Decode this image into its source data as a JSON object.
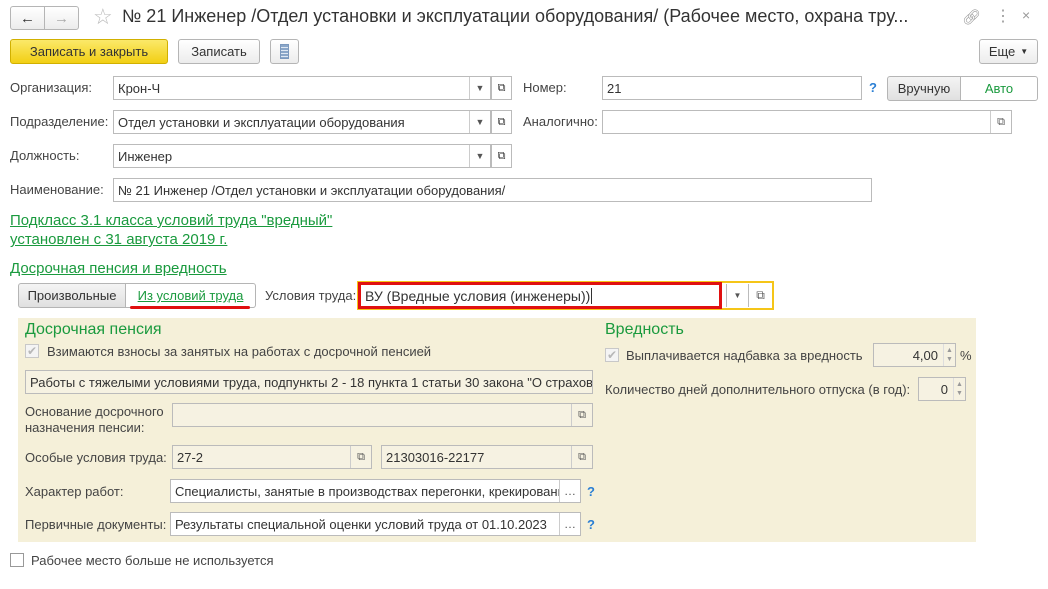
{
  "window": {
    "title": "№ 21 Инженер /Отдел установки и эксплуатации оборудования/ (Рабочее место, охрана тру..."
  },
  "toolbar": {
    "save_close": "Записать и закрыть",
    "save": "Записать",
    "more": "Еще"
  },
  "fields": {
    "org_label": "Организация:",
    "org_value": "Крон-Ч",
    "number_label": "Номер:",
    "number_value": "21",
    "help": "?",
    "manual": "Вручную",
    "auto": "Авто",
    "dept_label": "Подразделение:",
    "dept_value": "Отдел установки и эксплуатации оборудования",
    "similar_label": "Аналогично:",
    "similar_value": "",
    "position_label": "Должность:",
    "position_value": "Инженер",
    "name_label": "Наименование:",
    "name_value": "№ 21 Инженер /Отдел установки и эксплуатации оборудования/"
  },
  "subclass_link": {
    "line1": "Подкласс 3.1 класса условий труда \"вредный\"",
    "line2": "установлен с 31 августа 2019 г."
  },
  "section_link": "Досрочная пенсия и вредность",
  "mode": {
    "arbitrary": "Произвольные",
    "from_conditions": "Из условий труда"
  },
  "conditions": {
    "label": "Условия труда:",
    "value": "ВУ (Вредные условия (инженеры))"
  },
  "pension": {
    "title": "Досрочная пенсия",
    "checkbox": "Взимаются взносы за занятых на работах с досрочной пенсией",
    "law_text": "Работы с тяжелыми условиями труда, подпункты 2 - 18 пункта 1 статьи 30 закона \"О страхов",
    "basis_label1": "Основание досрочного",
    "basis_label2": "назначения пенсии:",
    "basis_value": "",
    "special_label": "Особые условия труда:",
    "special_value1": "27-2",
    "special_value2": "21303016-22177",
    "nature_label": "Характер работ:",
    "nature_value": "Специалисты, занятые в производствах перегонки, крекировани",
    "docs_label": "Первичные документы:",
    "docs_value": "Результаты специальной оценки условий труда от 01.10.2023"
  },
  "harm": {
    "title": "Вредность",
    "checkbox": "Выплачивается надбавка за вредность",
    "percent_value": "4,00",
    "percent_sign": "%",
    "days_label": "Количество дней дополнительного отпуска (в год):",
    "days_value": "0"
  },
  "bottom_checkbox": "Рабочее место больше не используется"
}
